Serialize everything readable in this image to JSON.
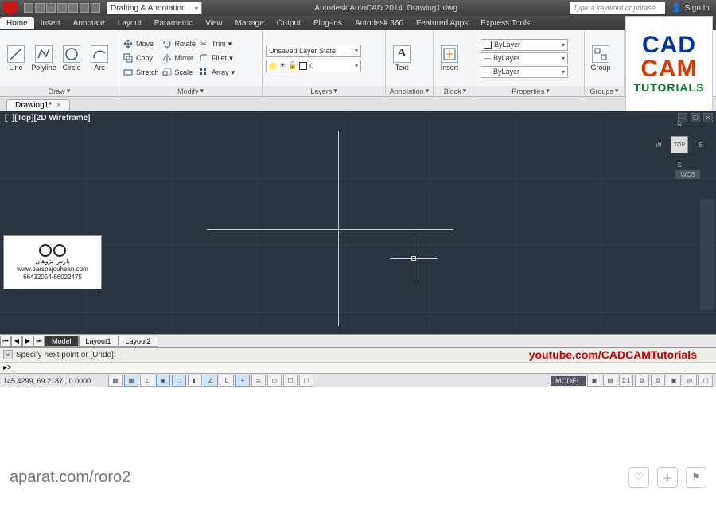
{
  "title": {
    "app": "Autodesk AutoCAD 2014",
    "file": "Drawing1.dwg"
  },
  "workspace": "Drafting & Annotation",
  "search_placeholder": "Type a keyword or phrase",
  "signin": "Sign In",
  "menu": [
    "Home",
    "Insert",
    "Annotate",
    "Layout",
    "Parametric",
    "View",
    "Manage",
    "Output",
    "Plug-ins",
    "Autodesk 360",
    "Featured Apps",
    "Express Tools"
  ],
  "active_menu": "Home",
  "ribbon": {
    "draw": {
      "title": "Draw",
      "items": [
        "Line",
        "Polyline",
        "Circle",
        "Arc"
      ]
    },
    "modify": {
      "title": "Modify",
      "rows": [
        [
          "Move",
          "Rotate",
          "Trim"
        ],
        [
          "Copy",
          "Mirror",
          "Fillet"
        ],
        [
          "Stretch",
          "Scale",
          "Array"
        ]
      ]
    },
    "layers": {
      "title": "Layers",
      "state": "Unsaved Layer State",
      "current": "0"
    },
    "annotation": {
      "title": "Annotation",
      "text": "Text"
    },
    "block": {
      "title": "Block",
      "insert": "Insert"
    },
    "properties": {
      "title": "Properties",
      "color": "ByLayer",
      "lw": "ByLayer",
      "lt": "ByLayer"
    },
    "groups": {
      "title": "Groups",
      "label": "Group"
    }
  },
  "filetab": "Drawing1*",
  "viewport_label": "[–][Top][2D Wireframe]",
  "viewcube": {
    "face": "TOP",
    "n": "N",
    "s": "S",
    "e": "E",
    "w": "W"
  },
  "wcs": "WCS",
  "watermark": {
    "name": "پارس پژوهان",
    "url": "www.parspajouhaan.com",
    "phone": "66432054-66022475"
  },
  "cad_logo": {
    "l1": "CAD",
    "l2": "CAM",
    "l3": "TUTORIALS"
  },
  "layout_tabs": [
    "Model",
    "Layout1",
    "Layout2"
  ],
  "cmd_history": "Specify next point or [Undo]:",
  "cmd_prompt": ">_",
  "yt": "youtube.com/CADCAMTutorials",
  "status": {
    "coords": "145.4299, 69.2187 , 0.0000",
    "model": "MODEL",
    "scale": "1:1"
  },
  "footer_src": "aparat.com/roro2"
}
